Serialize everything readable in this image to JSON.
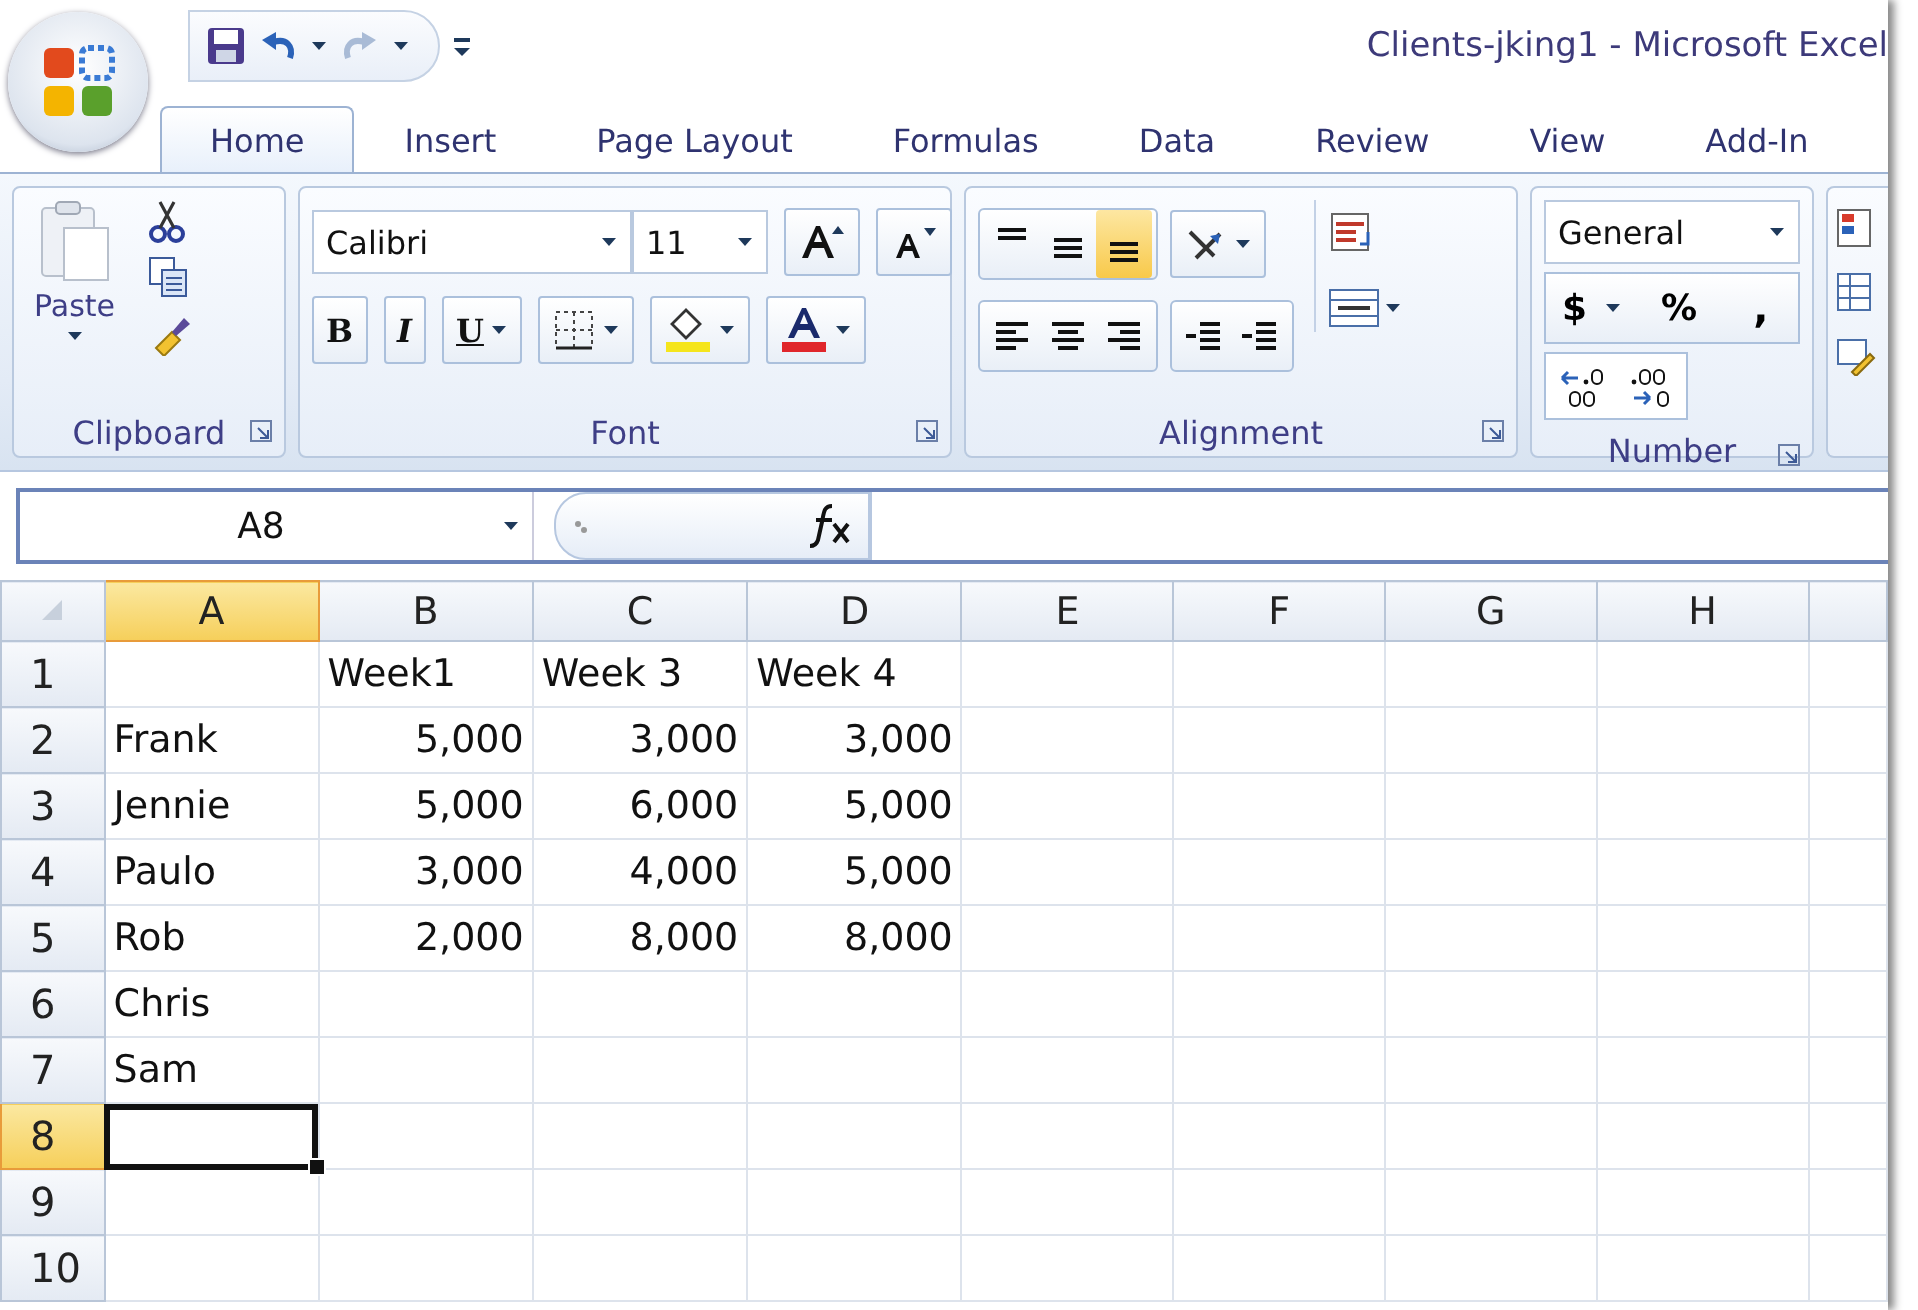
{
  "window": {
    "title": "Clients-jking1 - Microsoft Excel"
  },
  "tabs": [
    {
      "label": "Home",
      "selected": true
    },
    {
      "label": "Insert",
      "selected": false
    },
    {
      "label": "Page Layout",
      "selected": false
    },
    {
      "label": "Formulas",
      "selected": false
    },
    {
      "label": "Data",
      "selected": false
    },
    {
      "label": "Review",
      "selected": false
    },
    {
      "label": "View",
      "selected": false
    },
    {
      "label": "Add-In",
      "selected": false
    }
  ],
  "ribbon": {
    "clipboard": {
      "title": "Clipboard",
      "paste": "Paste"
    },
    "font": {
      "title": "Font",
      "name": "Calibri",
      "size": "11",
      "bold": "B",
      "italic": "I",
      "underline": "U"
    },
    "alignment": {
      "title": "Alignment",
      "vertical": [
        {
          "selected": false
        },
        {
          "selected": false
        },
        {
          "selected": true
        }
      ]
    },
    "number": {
      "title": "Number",
      "format": "General",
      "currency": "$",
      "percent": "%",
      "comma": ","
    }
  },
  "formula_bar": {
    "name_box": "A8"
  },
  "sheet": {
    "columns": [
      {
        "label": "A",
        "selected": true
      },
      {
        "label": "B",
        "selected": false
      },
      {
        "label": "C",
        "selected": false
      },
      {
        "label": "D",
        "selected": false
      },
      {
        "label": "E",
        "selected": false
      },
      {
        "label": "F",
        "selected": false
      },
      {
        "label": "G",
        "selected": false
      },
      {
        "label": "H",
        "selected": false
      }
    ],
    "rows": [
      {
        "label": "1",
        "selected": false,
        "cells": [
          null,
          {
            "text": "Week1",
            "kind": "text"
          },
          {
            "text": "Week 3",
            "kind": "text"
          },
          {
            "text": "Week 4",
            "kind": "text"
          }
        ]
      },
      {
        "label": "2",
        "selected": false,
        "cells": [
          {
            "text": "Frank",
            "kind": "text"
          },
          {
            "text": "5,000",
            "kind": "number"
          },
          {
            "text": "3,000",
            "kind": "number"
          },
          {
            "text": "3,000",
            "kind": "number"
          }
        ]
      },
      {
        "label": "3",
        "selected": false,
        "cells": [
          {
            "text": "Jennie",
            "kind": "text"
          },
          {
            "text": "5,000",
            "kind": "number"
          },
          {
            "text": "6,000",
            "kind": "number"
          },
          {
            "text": "5,000",
            "kind": "number"
          }
        ]
      },
      {
        "label": "4",
        "selected": false,
        "cells": [
          {
            "text": "Paulo",
            "kind": "text"
          },
          {
            "text": "3,000",
            "kind": "number"
          },
          {
            "text": "4,000",
            "kind": "number"
          },
          {
            "text": "5,000",
            "kind": "number"
          }
        ]
      },
      {
        "label": "5",
        "selected": false,
        "cells": [
          {
            "text": "Rob",
            "kind": "text"
          },
          {
            "text": "2,000",
            "kind": "number"
          },
          {
            "text": "8,000",
            "kind": "number"
          },
          {
            "text": "8,000",
            "kind": "number"
          }
        ]
      },
      {
        "label": "6",
        "selected": false,
        "cells": [
          {
            "text": "Chris",
            "kind": "text"
          }
        ]
      },
      {
        "label": "7",
        "selected": false,
        "cells": [
          {
            "text": "Sam",
            "kind": "text"
          }
        ]
      },
      {
        "label": "8",
        "selected": true
      },
      {
        "label": "9",
        "selected": false
      },
      {
        "label": "10",
        "selected": false
      }
    ]
  }
}
